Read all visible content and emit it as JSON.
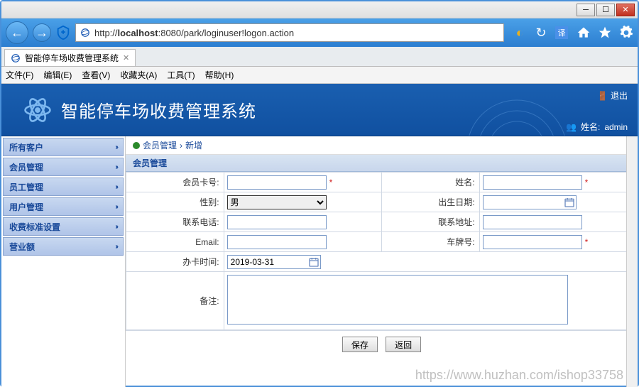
{
  "browser": {
    "url_display_prefix": "http://",
    "url_display_host": "localhost",
    "url_display_rest": ":8080/park/loginuser!logon.action",
    "tab_title": "智能停车场收费管理系统"
  },
  "menus": {
    "file": "文件(F)",
    "edit": "编辑(E)",
    "view": "查看(V)",
    "fav": "收藏夹(A)",
    "tools": "工具(T)",
    "help": "帮助(H)"
  },
  "header": {
    "app_title": "智能停车场收费管理系统",
    "logout": "退出",
    "username_label": "姓名:",
    "username": "admin"
  },
  "sidebar": {
    "items": [
      {
        "label": "所有客户"
      },
      {
        "label": "会员管理"
      },
      {
        "label": "员工管理"
      },
      {
        "label": "用户管理"
      },
      {
        "label": "收费标准设置"
      },
      {
        "label": "营业额"
      }
    ]
  },
  "breadcrumb": {
    "a": "会员管理",
    "sep": "›",
    "b": "新增"
  },
  "section_title": "会员管理",
  "form": {
    "card_no_label": "会员卡号:",
    "card_no": "",
    "name_label": "姓名:",
    "name": "",
    "gender_label": "性别:",
    "gender_selected": "男",
    "birth_label": "出生日期:",
    "birth": "",
    "phone_label": "联系电话:",
    "phone": "",
    "addr_label": "联系地址:",
    "addr": "",
    "email_label": "Email:",
    "email": "",
    "plate_label": "车牌号:",
    "plate": "",
    "apply_label": "办卡时间:",
    "apply_date": "2019-03-31",
    "remark_label": "备注:",
    "remark": ""
  },
  "buttons": {
    "save": "保存",
    "back": "返回"
  },
  "watermark": "https://www.huzhan.com/ishop33758"
}
